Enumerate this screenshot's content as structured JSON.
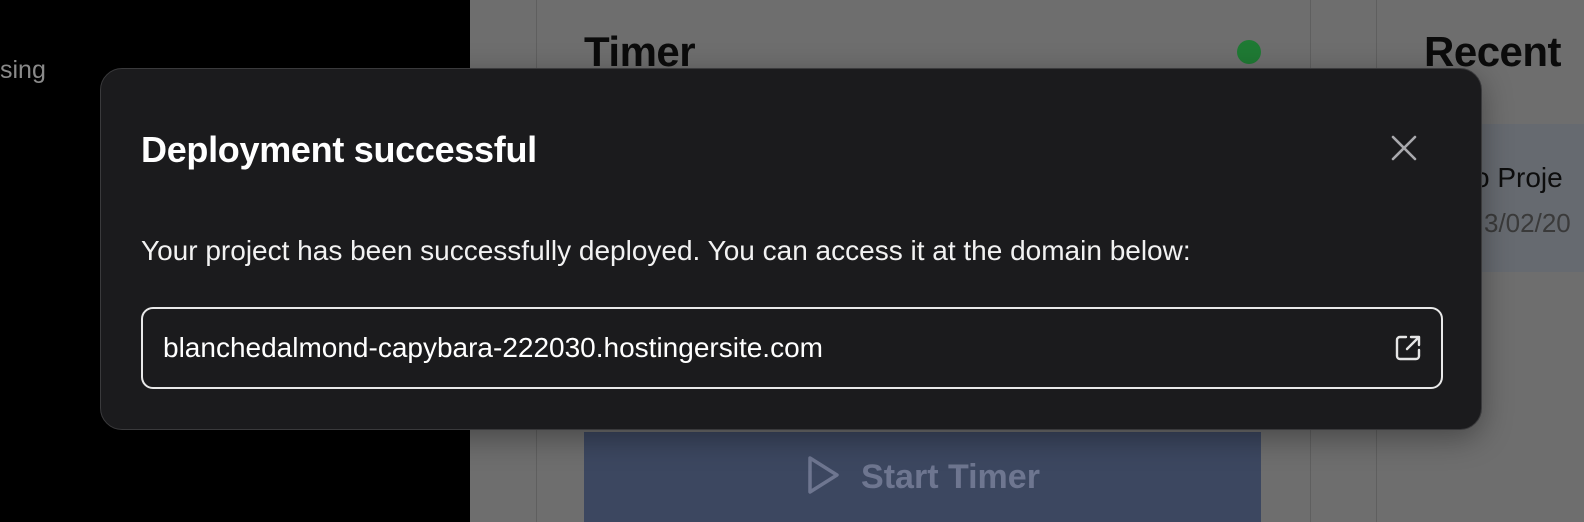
{
  "background": {
    "sidebar_partial_text": "sing",
    "timer_title": "Timer",
    "recent_title": "Recent",
    "recent_item": {
      "name": "o Proje",
      "date": "3/02/20"
    },
    "start_timer_label": "Start Timer",
    "status_dot_color": "#1f7a34"
  },
  "modal": {
    "title": "Deployment successful",
    "close_icon": "close-icon",
    "message": "Your project has been successfully deployed. You can access it at the domain below:",
    "domain": "blanchedalmond-capybara-222030.hostingersite.com",
    "open_icon": "external-link-icon"
  }
}
